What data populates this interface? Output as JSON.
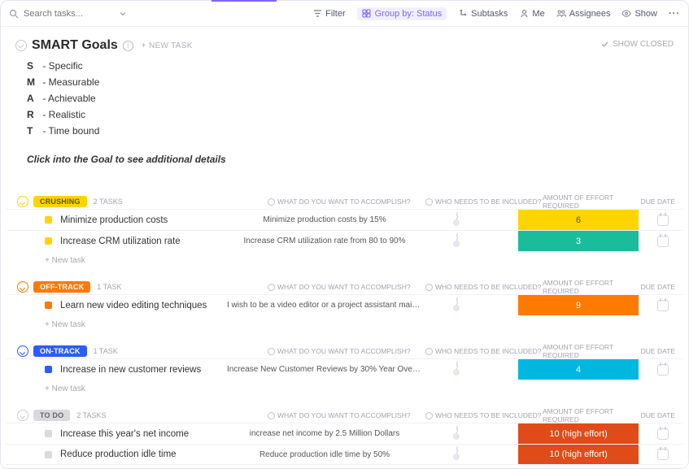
{
  "search": {
    "placeholder": "Search tasks..."
  },
  "toolbar": {
    "filter": "Filter",
    "group_by": "Group by: Status",
    "subtasks": "Subtasks",
    "me": "Me",
    "assignees": "Assignees",
    "show": "Show"
  },
  "title": "SMART Goals",
  "new_task_top": "+ NEW TASK",
  "show_closed": "SHOW CLOSED",
  "smart": [
    {
      "letter": "S",
      "word": "Specific"
    },
    {
      "letter": "M",
      "word": "Measurable"
    },
    {
      "letter": "A",
      "word": "Achievable"
    },
    {
      "letter": "R",
      "word": "Realistic"
    },
    {
      "letter": "T",
      "word": "Time bound"
    }
  ],
  "hint": "Click into the Goal to see additional details",
  "columns": {
    "accomplish": "WHAT DO YOU WANT TO ACCOMPLISH?",
    "included": "WHO NEEDS TO BE INCLUDED?",
    "effort": "AMOUNT OF EFFORT REQUIRED",
    "due": "DUE DATE"
  },
  "add_task": "+ New task",
  "groups": [
    {
      "name": "CRUSHING",
      "count": "2 TASKS",
      "pill_class": "pill-yellow",
      "tgl_class": "tgl-yellow",
      "sq_class": "sq-yellow",
      "tasks": [
        {
          "title": "Minimize production costs",
          "accomplish": "Minimize production costs by 15%",
          "effort": "6",
          "ef_class": "ef-yellow"
        },
        {
          "title": "Increase CRM utilization rate",
          "accomplish": "Increase CRM utilization rate from 80 to 90%",
          "effort": "3",
          "ef_class": "ef-teal"
        }
      ]
    },
    {
      "name": "OFF-TRACK",
      "count": "1 TASK",
      "pill_class": "pill-orange",
      "tgl_class": "tgl-orange",
      "sq_class": "sq-orange",
      "tasks": [
        {
          "title": "Learn new video editing techniques",
          "accomplish": "I wish to be a video editor or a project assistant mainly ...",
          "effort": "9",
          "ef_class": "ef-orange"
        }
      ]
    },
    {
      "name": "ON-TRACK",
      "count": "1 TASK",
      "pill_class": "pill-blue",
      "tgl_class": "tgl-blue",
      "sq_class": "sq-blue",
      "tasks": [
        {
          "title": "Increase in new customer reviews",
          "accomplish": "Increase New Customer Reviews by 30% Year Over Year...",
          "effort": "4",
          "ef_class": "ef-cyan"
        }
      ]
    },
    {
      "name": "TO DO",
      "count": "2 TASKS",
      "pill_class": "pill-grey",
      "tgl_class": "tgl-grey",
      "sq_class": "sq-grey",
      "hide_add": true,
      "tasks": [
        {
          "title": "Increase this year's net income",
          "accomplish": "increase net income by 2.5 Million Dollars",
          "effort": "10 (high effort)",
          "ef_class": "ef-red"
        },
        {
          "title": "Reduce production idle time",
          "accomplish": "Reduce production idle time by 50%",
          "effort": "10 (high effort)",
          "ef_class": "ef-red"
        }
      ]
    }
  ]
}
